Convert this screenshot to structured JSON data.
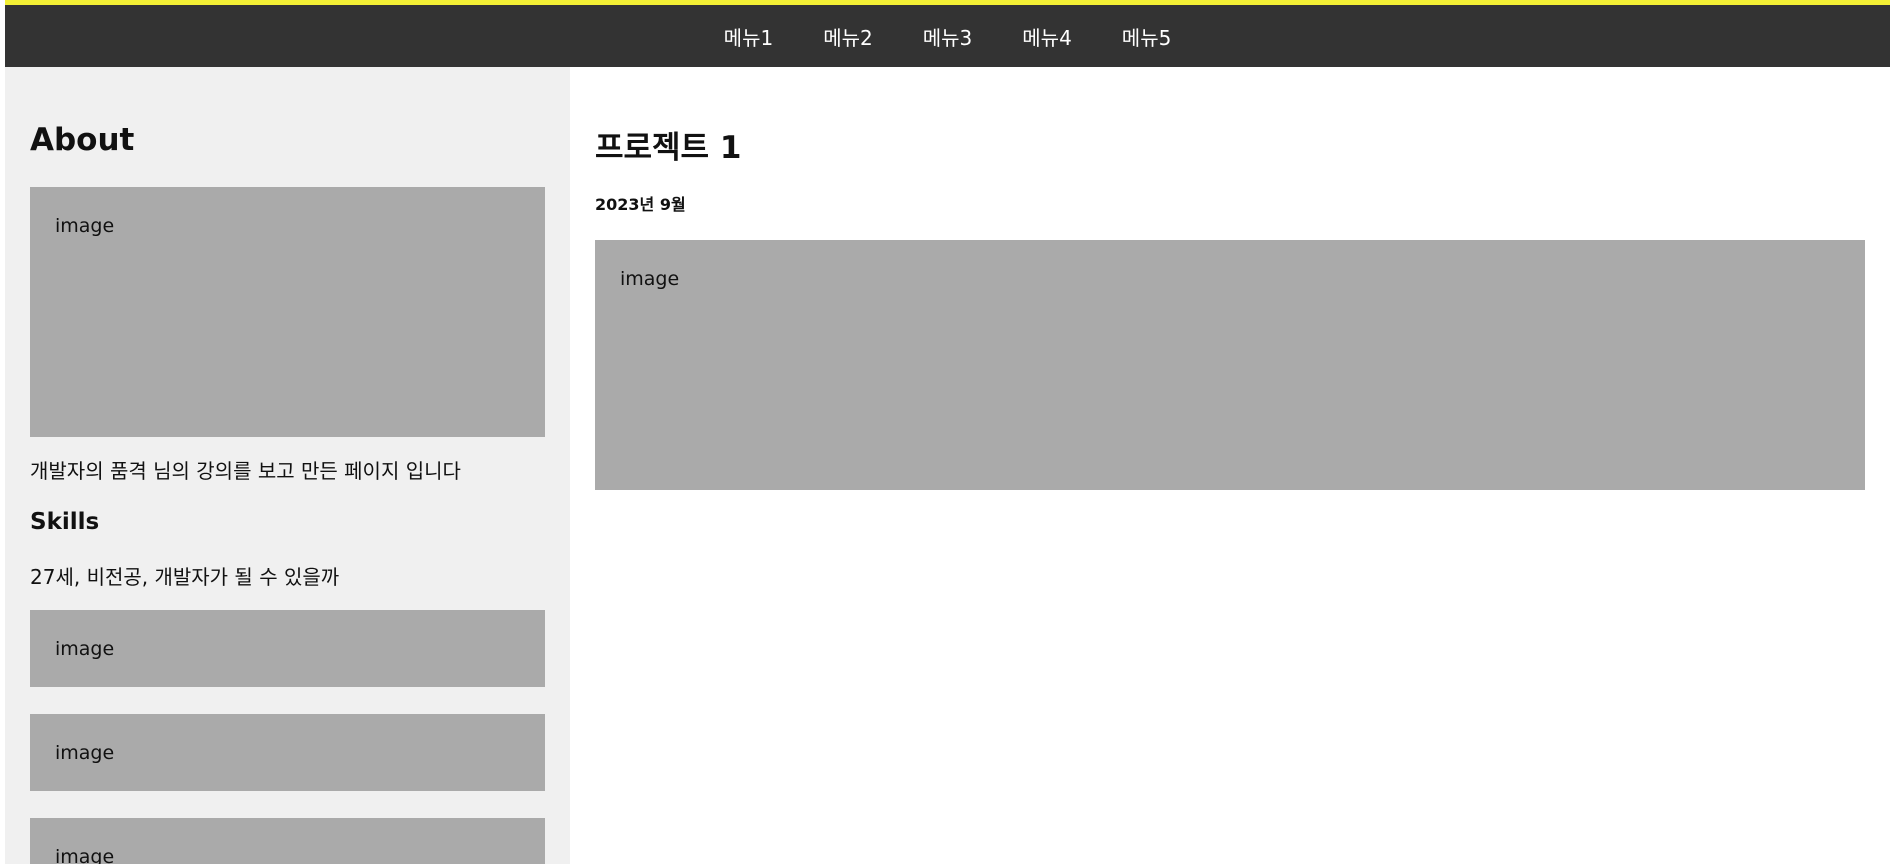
{
  "nav": {
    "items": [
      {
        "label": "메뉴1"
      },
      {
        "label": "메뉴2"
      },
      {
        "label": "메뉴3"
      },
      {
        "label": "메뉴4"
      },
      {
        "label": "메뉴5"
      }
    ]
  },
  "sidebar": {
    "about_title": "About",
    "profile_image_label": "image",
    "intro_text": "개발자의 품격 님의 강의를 보고 만든 페이지 입니다",
    "skills_title": "Skills",
    "skills_text": "27세, 비전공, 개발자가 될 수 있을까",
    "skill_images": [
      {
        "label": "image"
      },
      {
        "label": "image"
      },
      {
        "label": "image"
      }
    ]
  },
  "main": {
    "project_title": "프로젝트 1",
    "project_date": "2023년 9월",
    "project_image_label": "image"
  },
  "colors": {
    "accent_stripe": "#f3f035",
    "navbar_bg": "#333333",
    "sidebar_bg": "#f0f0f0",
    "image_placeholder": "#aaaaaa"
  }
}
